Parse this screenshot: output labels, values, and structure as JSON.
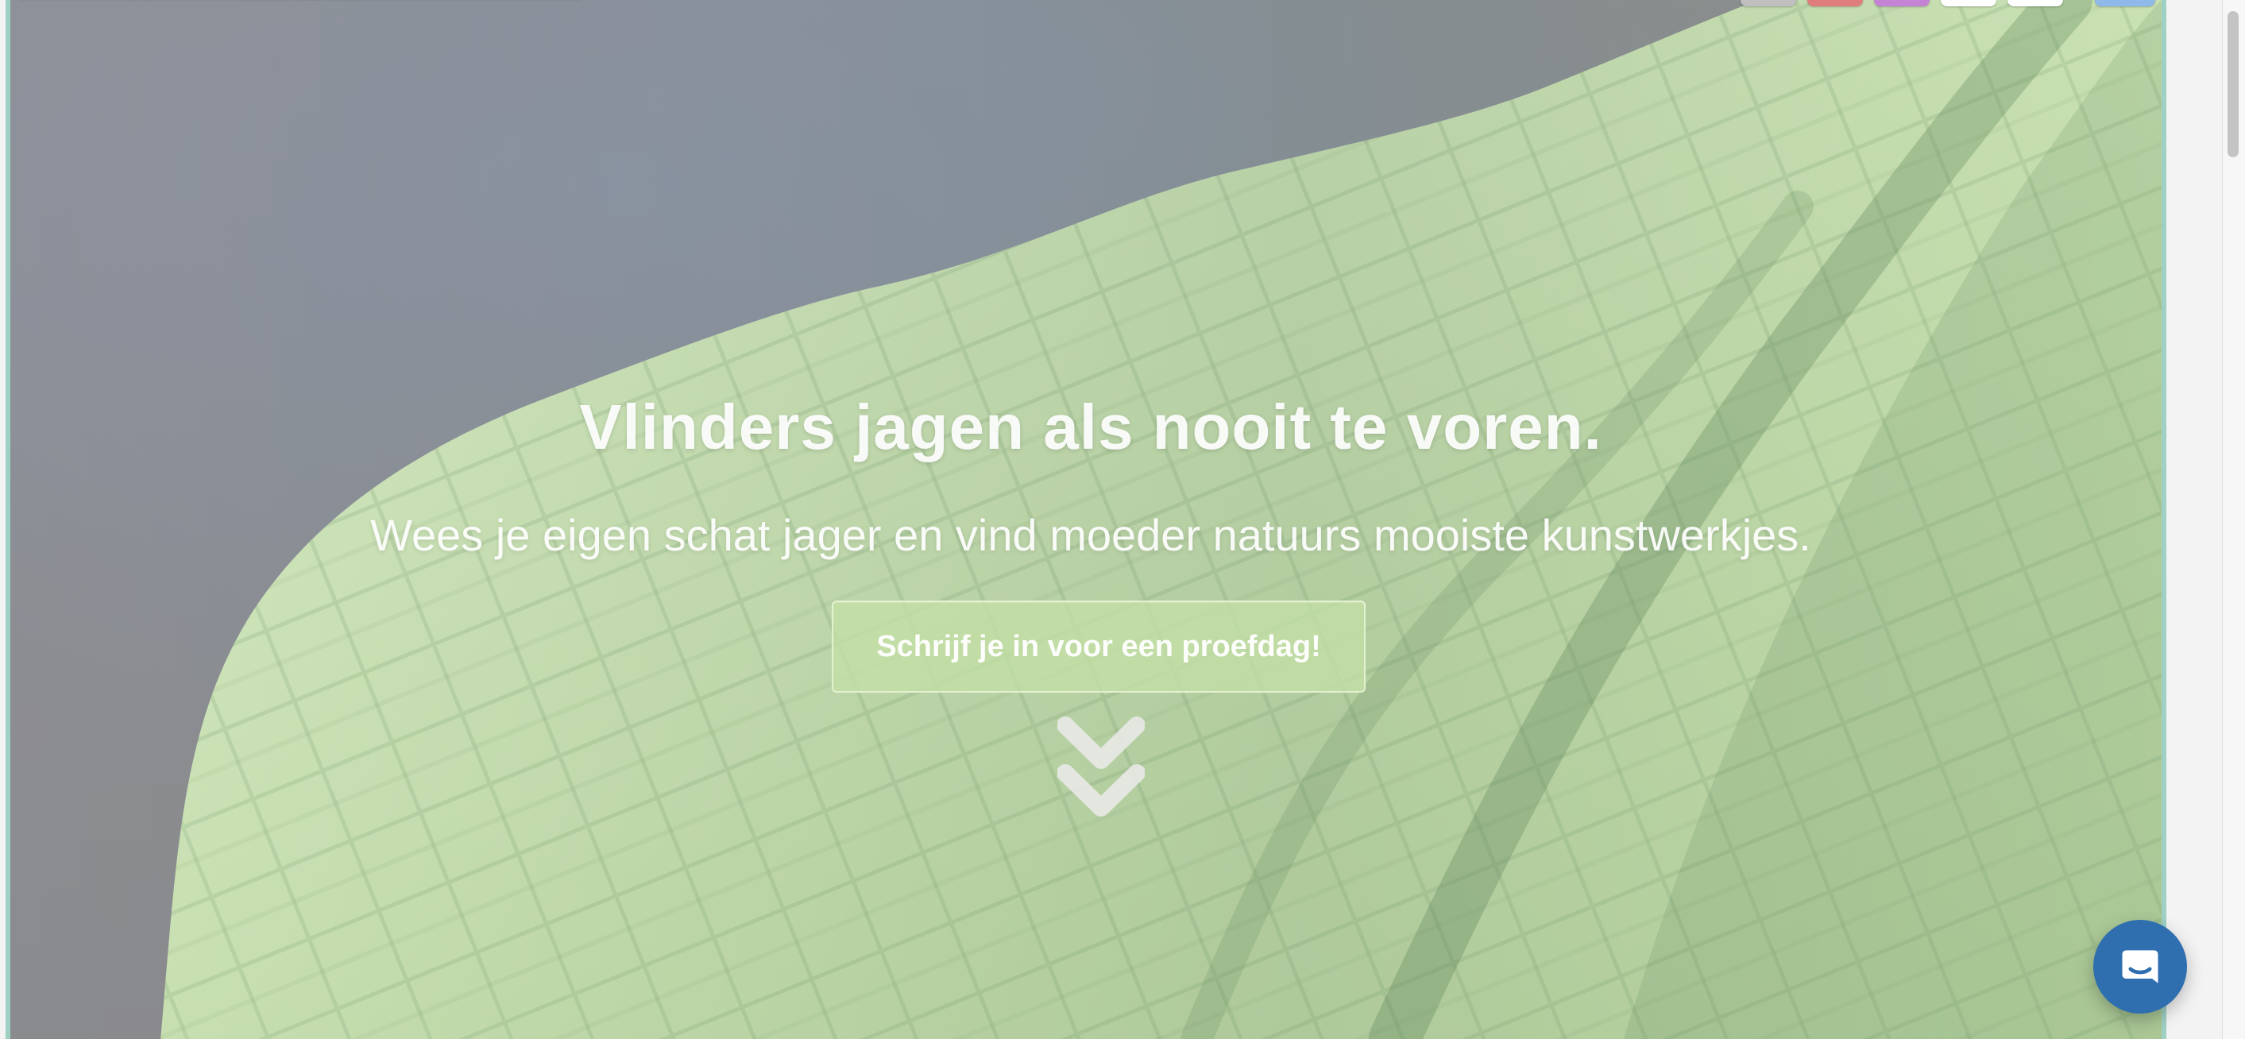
{
  "hero": {
    "title": "Vlinders jagen als nooit te voren.",
    "subtitle": "Wees je eigen schat jager en vind moeder natuurs mooiste kunstwerkjes.",
    "cta_label": "Schrijf je in voor een proefdag!"
  },
  "top_strip": {
    "chip_colors": [
      "#bfbfbf",
      "#e07c7c",
      "#c583d6",
      "#ffffff",
      "#ffffff",
      "#8fb9e8"
    ]
  },
  "icons": {
    "scroll_down": "double-chevron-down-icon",
    "chat": "chat-bubble-icon"
  },
  "colors": {
    "frame_accent": "#9fd0c4",
    "cta_bg": "#c4dfa5",
    "chat_launcher": "#2f6fb0"
  }
}
